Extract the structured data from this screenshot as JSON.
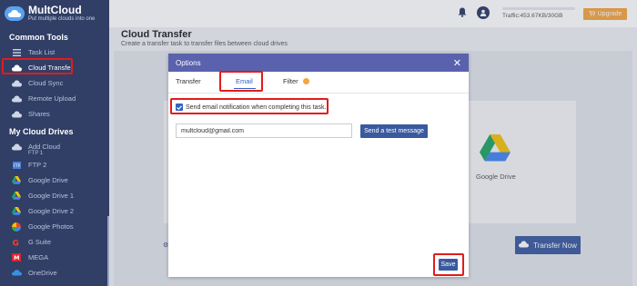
{
  "brand": {
    "name": "MultCloud",
    "slogan": "Put multiple clouds into one"
  },
  "sidebar": {
    "common_tools_title": "Common Tools",
    "tools": [
      {
        "label": "Task List",
        "icon": "list-icon"
      },
      {
        "label": "Cloud Transfer",
        "icon": "cloud-transfer-icon"
      },
      {
        "label": "Cloud Sync",
        "icon": "cloud-sync-icon"
      },
      {
        "label": "Remote Upload",
        "icon": "remote-upload-icon"
      },
      {
        "label": "Shares",
        "icon": "share-icon"
      }
    ],
    "drives_title": "My Cloud Drives",
    "drives": [
      {
        "label": "Add Cloud",
        "icon": "add-cloud-icon"
      },
      {
        "label": "FTP 1",
        "icon": "ftp-icon"
      },
      {
        "label": "FTP 2",
        "icon": "ftp-icon"
      },
      {
        "label": "Google Drive",
        "icon": "google-drive-icon"
      },
      {
        "label": "Google Drive 1",
        "icon": "google-drive-icon"
      },
      {
        "label": "Google Drive 2",
        "icon": "google-drive-icon"
      },
      {
        "label": "Google Photos",
        "icon": "google-photos-icon"
      },
      {
        "label": "G Suite",
        "icon": "g-suite-icon"
      },
      {
        "label": "MEGA",
        "icon": "mega-icon"
      },
      {
        "label": "OneDrive",
        "icon": "onedrive-icon"
      }
    ]
  },
  "topbar": {
    "traffic": "Traffic:453.67KB/30GB",
    "upgrade": "Upgrade"
  },
  "main": {
    "title": "Cloud Transfer",
    "description": "Create a transfer task to transfer files between cloud drives",
    "dest_label": "Google Drive",
    "transfer_now": "Transfer Now"
  },
  "modal": {
    "title": "Options",
    "tabs": [
      "Transfer",
      "Email",
      "Filter"
    ],
    "active_tab": "Email",
    "checkbox_label": "Send email notification when completing this task.",
    "checkbox_checked": true,
    "email_value": "multcloud@gmail.com",
    "test_button": "Send a test message",
    "save_button": "Save"
  },
  "colors": {
    "sidebar_bg": "#313e66",
    "modal_header": "#5a61ad",
    "primary_button": "#3a5aa0",
    "upgrade": "#f5a541",
    "highlight": "#e21b1b"
  }
}
